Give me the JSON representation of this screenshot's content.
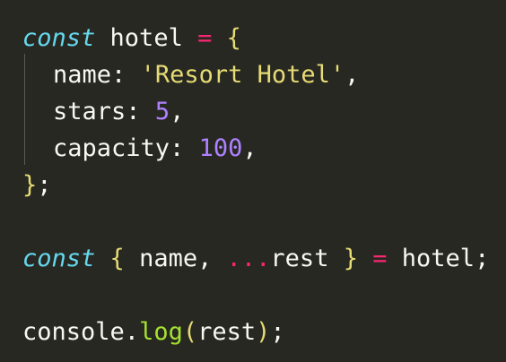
{
  "code": {
    "l1": {
      "kw": "const",
      "ident": "hotel",
      "eq": "=",
      "open": "{"
    },
    "l2": {
      "key": "name",
      "colon": ":",
      "value": "'Resort Hotel'",
      "comma": ","
    },
    "l3": {
      "key": "stars",
      "colon": ":",
      "value": "5",
      "comma": ","
    },
    "l4": {
      "key": "capacity",
      "colon": ":",
      "value": "100",
      "comma": ","
    },
    "l5": {
      "close": "}",
      "semi": ";"
    },
    "l7": {
      "kw": "const",
      "open": "{",
      "name": "name",
      "comma": ",",
      "spread": "...",
      "rest": "rest",
      "close": "}",
      "eq": "=",
      "ident": "hotel",
      "semi": ";"
    },
    "l9": {
      "obj": "console",
      "dot": ".",
      "method": "log",
      "open": "(",
      "arg": "rest",
      "close": ")",
      "semi": ";"
    }
  }
}
